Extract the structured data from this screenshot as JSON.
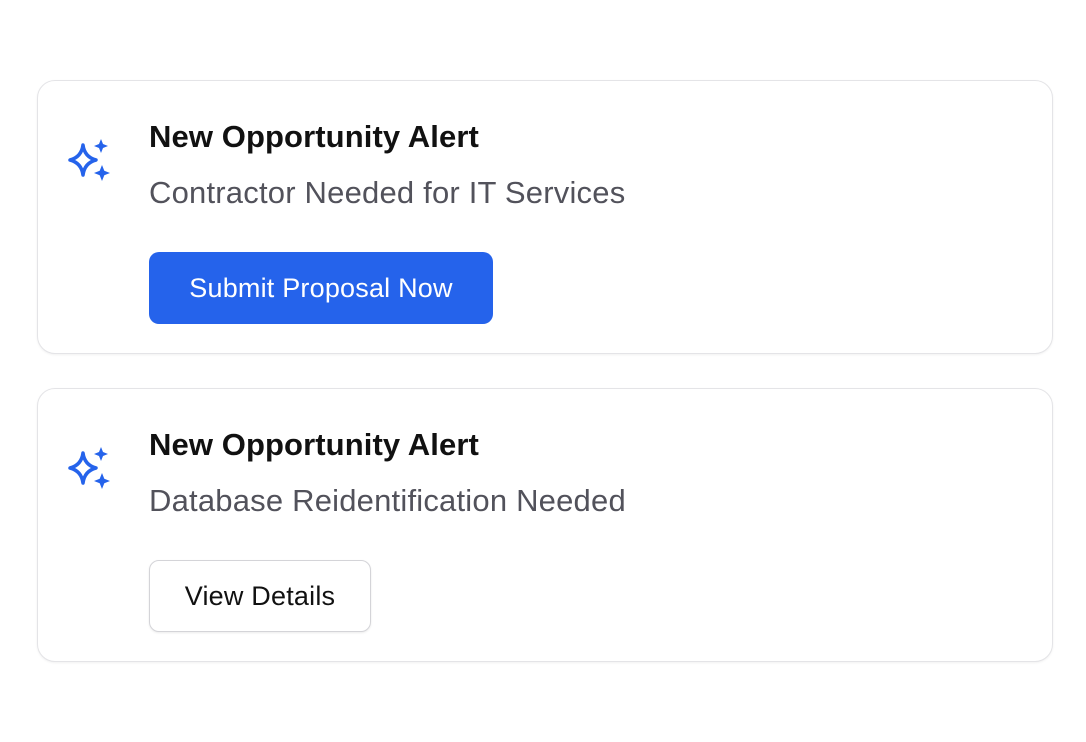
{
  "colors": {
    "accent": "#2563eb",
    "icon": "#2563eb",
    "title": "#111111",
    "subtitle": "#52525b",
    "border": "#e4e4e7"
  },
  "alerts": [
    {
      "icon": "sparkles-icon",
      "title": "New Opportunity Alert",
      "subtitle": "Contractor Needed for IT Services",
      "action_label": "Submit Proposal Now",
      "action_style": "primary"
    },
    {
      "icon": "sparkles-icon",
      "title": "New Opportunity Alert",
      "subtitle": "Database Reidentification Needed",
      "action_label": "View Details",
      "action_style": "secondary"
    }
  ]
}
